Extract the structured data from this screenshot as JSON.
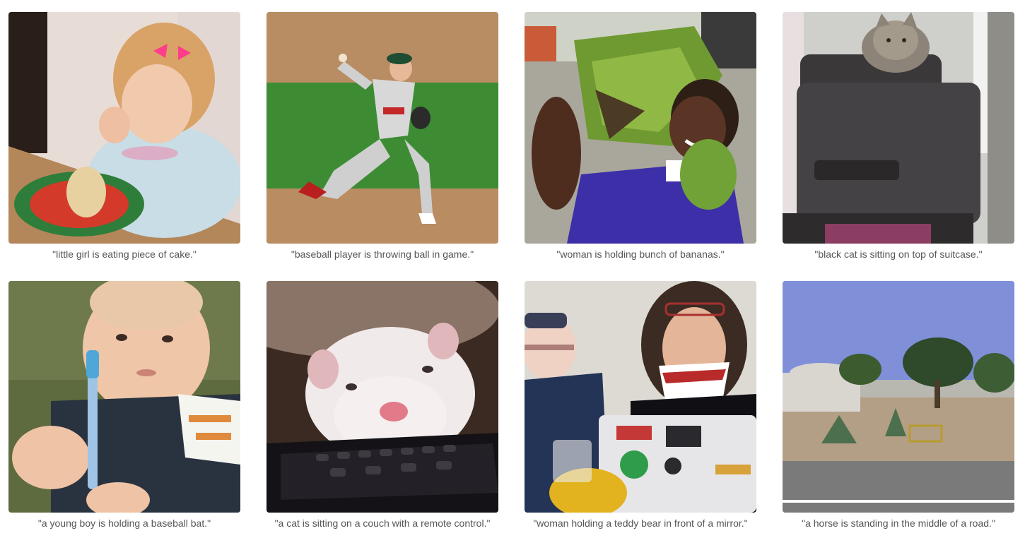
{
  "gallery": {
    "items": [
      {
        "caption": "\"little girl is eating piece of cake.\"",
        "image_subject": "girl-eating-cake"
      },
      {
        "caption": "\"baseball player is throwing ball in game.\"",
        "image_subject": "baseball-pitcher"
      },
      {
        "caption": "\"woman is holding bunch of bananas.\"",
        "image_subject": "woman-with-bananas"
      },
      {
        "caption": "\"black cat is sitting on top of suitcase.\"",
        "image_subject": "cat-on-suitcase"
      },
      {
        "caption": "\"a young boy is holding a baseball bat.\"",
        "image_subject": "baby-with-toothbrush"
      },
      {
        "caption": "\"a cat is sitting on a couch with a remote control.\"",
        "image_subject": "ferret-on-remote"
      },
      {
        "caption": "\"woman holding a teddy bear in front of a mirror.\"",
        "image_subject": "people-with-laptop"
      },
      {
        "caption": "\"a horse is standing in the middle of a road.\"",
        "image_subject": "roadside-landscape"
      }
    ]
  }
}
